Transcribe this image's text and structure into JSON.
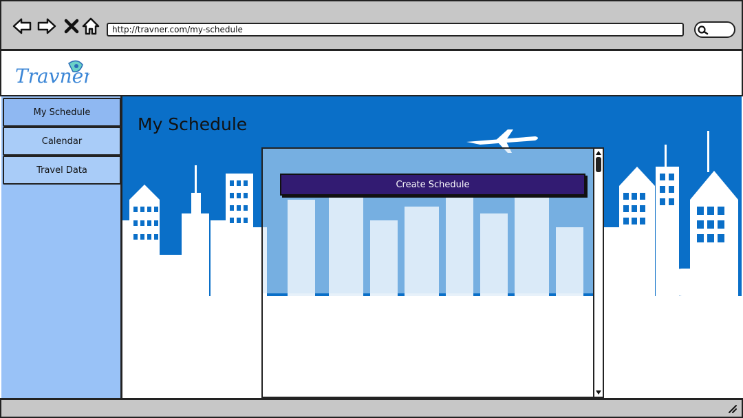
{
  "browser": {
    "url": "http://travner.com/my-schedule",
    "nav_icons": [
      "back-arrow-icon",
      "forward-arrow-icon",
      "close-x-icon",
      "home-icon"
    ],
    "search_icon": "search-icon"
  },
  "header": {
    "logo_text": "Travner"
  },
  "sidebar": {
    "items": [
      {
        "label": "My Schedule"
      },
      {
        "label": "Calendar"
      },
      {
        "label": "Travel Data"
      }
    ]
  },
  "main": {
    "title": "My Schedule",
    "create_button_label": "Create Schedule"
  },
  "colors": {
    "sky": "#0a6fc8",
    "sidebar": "#99c2f7",
    "button": "#321b72",
    "chrome": "#c7c7c7"
  }
}
